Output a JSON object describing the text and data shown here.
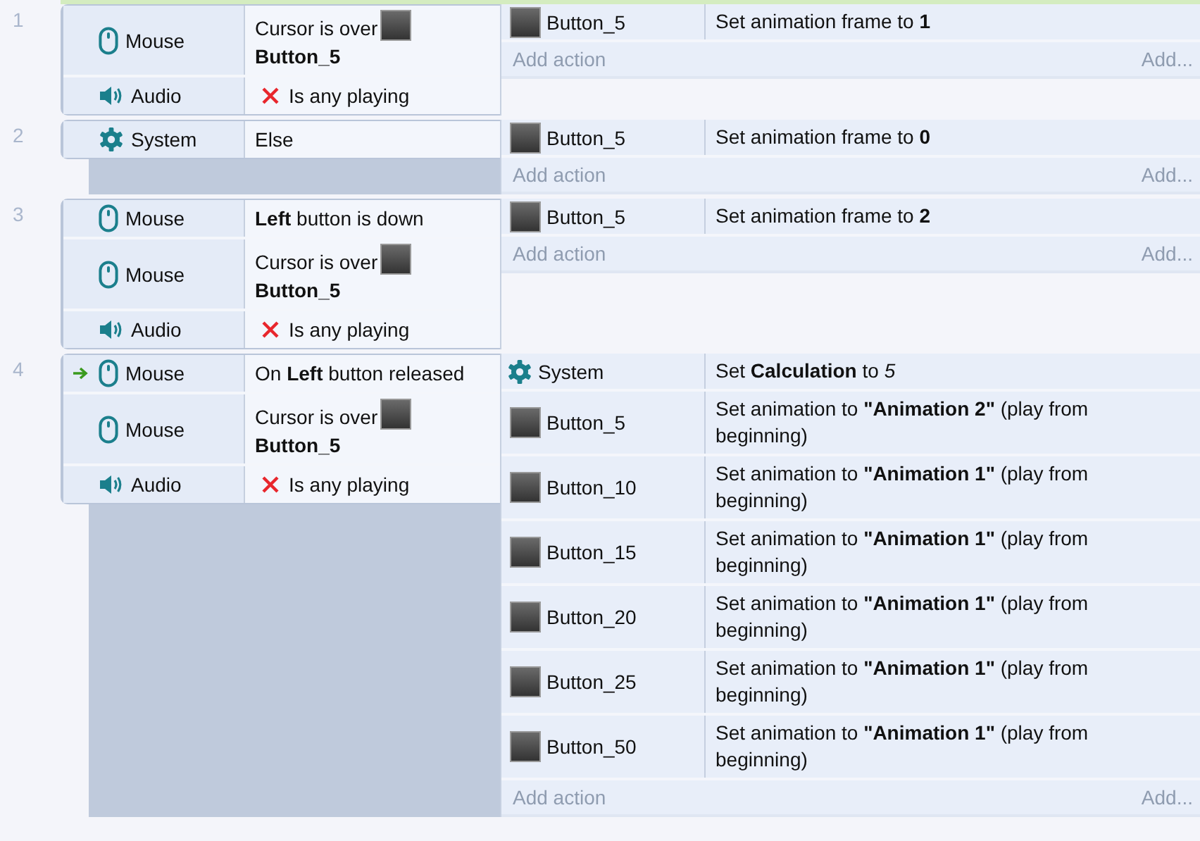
{
  "events": [
    {
      "number": "1",
      "conditions": [
        {
          "kind": "mouse",
          "object": "Mouse",
          "text": "Cursor is over",
          "target": "Button_5",
          "inverted": false,
          "trigger": false
        },
        {
          "kind": "audio",
          "object": "Audio",
          "text": "Is any playing",
          "inverted": true,
          "trigger": false
        }
      ],
      "actions": [
        {
          "kind": "sprite",
          "object": "Button_5",
          "text": "Set animation frame to **1**"
        }
      ],
      "add_action": "Add action",
      "add_more": "Add..."
    },
    {
      "number": "2",
      "conditions": [
        {
          "kind": "system",
          "object": "System",
          "text": "Else",
          "inverted": false,
          "trigger": false
        }
      ],
      "actions": [
        {
          "kind": "sprite",
          "object": "Button_5",
          "text": "Set animation frame to **0**"
        }
      ],
      "add_action": "Add action",
      "add_more": "Add..."
    },
    {
      "number": "3",
      "conditions": [
        {
          "kind": "mouse",
          "object": "Mouse",
          "text": "**Left** button is down",
          "inverted": false,
          "trigger": false
        },
        {
          "kind": "mouse",
          "object": "Mouse",
          "text": "Cursor is over",
          "target": "Button_5",
          "inverted": false,
          "trigger": false
        },
        {
          "kind": "audio",
          "object": "Audio",
          "text": "Is any playing",
          "inverted": true,
          "trigger": false
        }
      ],
      "actions": [
        {
          "kind": "sprite",
          "object": "Button_5",
          "text": "Set animation frame to **2**"
        }
      ],
      "add_action": "Add action",
      "add_more": "Add..."
    },
    {
      "number": "4",
      "conditions": [
        {
          "kind": "mouse",
          "object": "Mouse",
          "text": "On **Left** button released",
          "inverted": false,
          "trigger": true
        },
        {
          "kind": "mouse",
          "object": "Mouse",
          "text": "Cursor is over",
          "target": "Button_5",
          "inverted": false,
          "trigger": false
        },
        {
          "kind": "audio",
          "object": "Audio",
          "text": "Is any playing",
          "inverted": true,
          "trigger": false
        }
      ],
      "actions": [
        {
          "kind": "system",
          "object": "System",
          "text": "Set **Calculation** to *5*"
        },
        {
          "kind": "sprite",
          "object": "Button_5",
          "text": "Set animation to **\"Animation 2\"** (play from beginning)"
        },
        {
          "kind": "sprite",
          "object": "Button_10",
          "text": "Set animation to **\"Animation 1\"** (play from beginning)"
        },
        {
          "kind": "sprite",
          "object": "Button_15",
          "text": "Set animation to **\"Animation 1\"** (play from beginning)"
        },
        {
          "kind": "sprite",
          "object": "Button_20",
          "text": "Set animation to **\"Animation 1\"** (play from beginning)"
        },
        {
          "kind": "sprite",
          "object": "Button_25",
          "text": "Set animation to **\"Animation 1\"** (play from beginning)"
        },
        {
          "kind": "sprite",
          "object": "Button_50",
          "text": "Set animation to **\"Animation 1\"** (play from beginning)"
        }
      ],
      "add_action": "Add action",
      "add_more": "Add..."
    }
  ]
}
